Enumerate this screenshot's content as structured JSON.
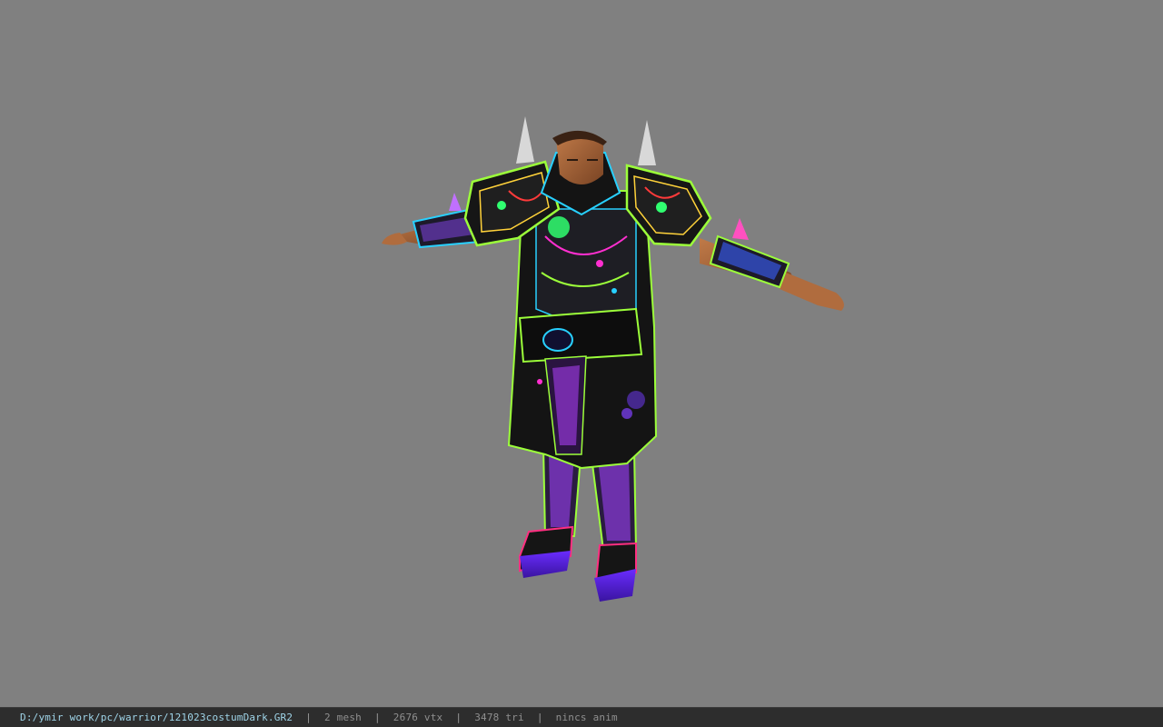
{
  "viewer": {
    "background_color": "#808080"
  },
  "model": {
    "icon": "armored-warrior-model",
    "colors": {
      "armor_base": "#141414",
      "trim_green": "#9cff3a",
      "trim_cyan": "#28d0ff",
      "accent_purple": "#a040ff",
      "accent_magenta": "#ff2fd0",
      "skin": "#a8663a",
      "spike": "#d8d8d8"
    }
  },
  "statusbar": {
    "file_path": "D:/ymir work/pc/warrior/121023costumDark.GR2",
    "separator": "|",
    "mesh": "2 mesh",
    "vertices": "2676 vtx",
    "triangles": "3478 tri",
    "anim": "nincs anim"
  }
}
